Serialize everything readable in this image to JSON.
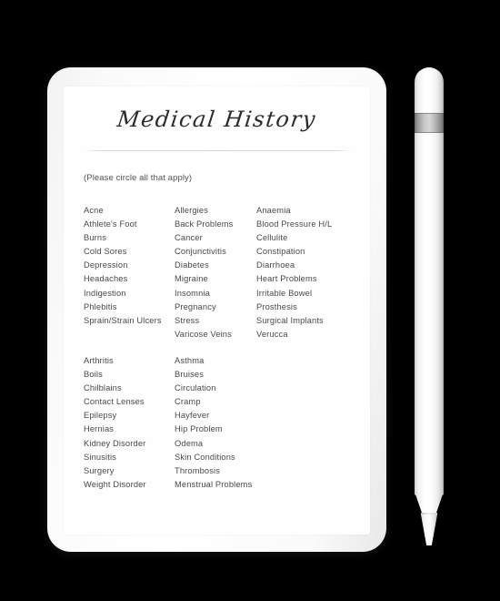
{
  "device": {
    "type": "tablet",
    "accessory": "stylus-pen"
  },
  "document": {
    "title": "Medical History",
    "divider": true,
    "instruction": "(Please circle all that apply)",
    "blocks": [
      {
        "name": "primary-conditions",
        "columns": [
          {
            "items": [
              "Acne",
              "Athlete's Foot",
              "Burns",
              "Cold Sores",
              "Depression",
              "Headaches",
              "Indigestion",
              "Phlebitis",
              "Sprain/Strain Ulcers"
            ]
          },
          {
            "items": [
              "Allergies",
              "Back Problems",
              "Cancer",
              "Conjunctivitis",
              "Diabetes",
              "Migraine",
              "Insomnia",
              "Pregnancy",
              "Stress",
              "Varicose Veins"
            ]
          },
          {
            "items": [
              "Anaemia",
              "Blood Pressure H/L",
              "Cellulite",
              "Constipation",
              "Diarrhoea",
              "Heart Problems",
              "Irritable Bowel",
              "Prosthesis",
              "Surgical Implants",
              "Verucca"
            ]
          }
        ]
      },
      {
        "name": "secondary-conditions",
        "columns": [
          {
            "items": [
              "Arthritis",
              "Boils",
              "Chilblains",
              "Contact Lenses",
              "Epilepsy",
              "Hernias",
              "Kidney Disorder",
              "Sinusitis",
              "Surgery",
              "Weight Disorder"
            ]
          },
          {
            "items": [
              "Asthma",
              "Bruises",
              "Circulation",
              "Cramp",
              "Hayfever",
              "Hip Problem",
              "Odema",
              "Skin Conditions",
              "Thrombosis",
              "Menstrual Problems"
            ]
          },
          {
            "items": []
          }
        ]
      }
    ]
  },
  "colors": {
    "background": "#000000",
    "device_body": "#ffffff",
    "page": "#fefefe",
    "text": "#4a4a4a",
    "title_text": "#2b2b2b",
    "divider": "#d4d4d4",
    "stylus_band": "#9c9c9c"
  }
}
